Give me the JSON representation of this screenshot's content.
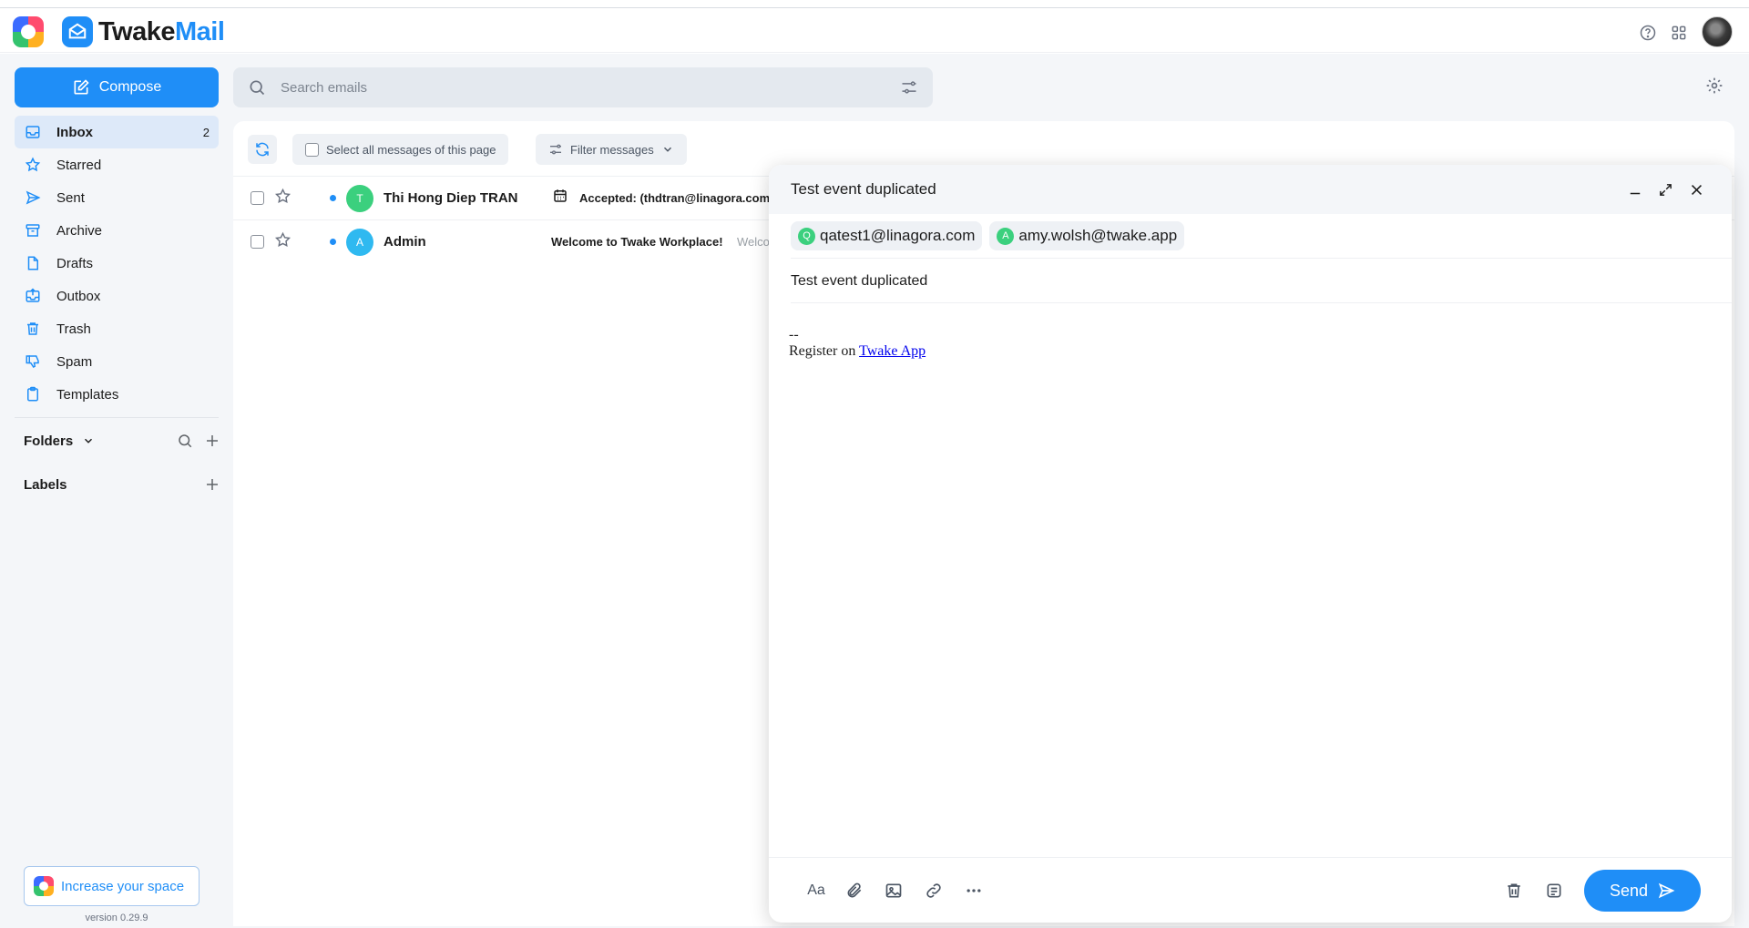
{
  "app": {
    "brand_part1": "Twake",
    "brand_part2": "Mail",
    "version": "version 0.29.9"
  },
  "colors": {
    "accent": "#1f8ef7",
    "active_nav_bg": "#dde9f9",
    "unread_dot": "#1f8ef7"
  },
  "header": {
    "icons": [
      "help-icon",
      "apps-grid-icon",
      "user-avatar"
    ]
  },
  "sidebar": {
    "compose_label": "Compose",
    "items": [
      {
        "label": "Inbox",
        "icon": "inbox-icon",
        "count": "2",
        "active": true
      },
      {
        "label": "Starred",
        "icon": "star-icon"
      },
      {
        "label": "Sent",
        "icon": "send-icon"
      },
      {
        "label": "Archive",
        "icon": "archive-icon"
      },
      {
        "label": "Drafts",
        "icon": "draft-icon"
      },
      {
        "label": "Outbox",
        "icon": "outbox-icon"
      },
      {
        "label": "Trash",
        "icon": "trash-icon"
      },
      {
        "label": "Spam",
        "icon": "spam-icon"
      },
      {
        "label": "Templates",
        "icon": "templates-icon"
      }
    ],
    "folders_label": "Folders",
    "labels_label": "Labels",
    "increase_space_label": "Increase your space"
  },
  "search": {
    "placeholder": "Search emails"
  },
  "toolbar": {
    "select_all_label": "Select all messages of this page",
    "filter_label": "Filter messages"
  },
  "emails": [
    {
      "sender": "Thi Hong Diep TRAN",
      "avatar_letter": "T",
      "avatar_color": "#3bd07e",
      "subject": "Accepted: (thdtran@linagora.com",
      "has_calendar_icon": true,
      "preview": ""
    },
    {
      "sender": "Admin",
      "avatar_letter": "A",
      "avatar_color": "#2fb9f0",
      "subject": "Welcome to Twake Workplace!",
      "has_calendar_icon": false,
      "preview": "Welco"
    }
  ],
  "composer": {
    "title": "Test event duplicated",
    "recipients": [
      {
        "letter": "Q",
        "email": "qatest1@linagora.com"
      },
      {
        "letter": "A",
        "email": "amy.wolsh@twake.app"
      }
    ],
    "subject": "Test event duplicated",
    "signature_dash": "--",
    "signature_text": "Register on ",
    "signature_link": "Twake App",
    "format_label": "Aa",
    "send_label": "Send"
  }
}
